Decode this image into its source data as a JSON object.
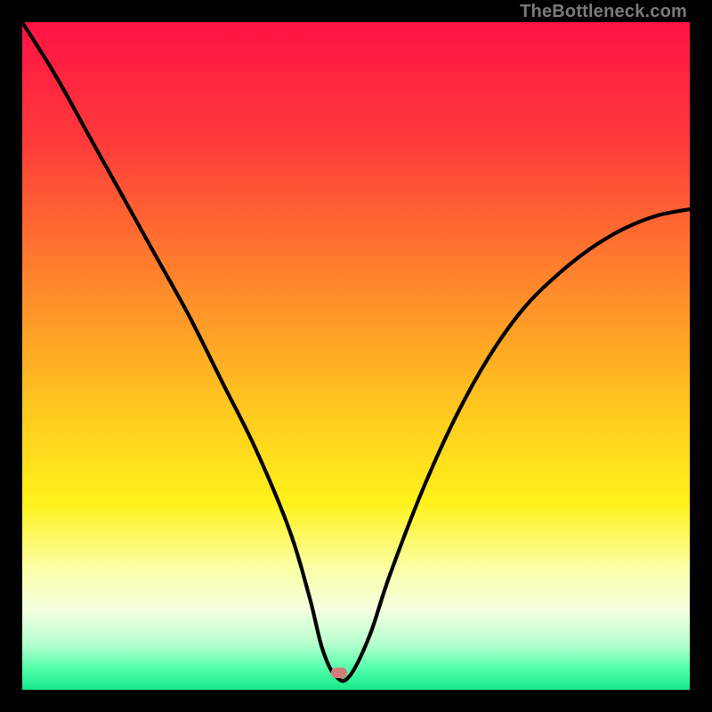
{
  "watermark": "TheBottleneck.com",
  "marker": {
    "x_pct": 47.5,
    "y_pct": 97.5,
    "color": "#d77a7a"
  },
  "gradient_stops": [
    {
      "offset": 0,
      "color": "#ff1244"
    },
    {
      "offset": 18,
      "color": "#ff3b3a"
    },
    {
      "offset": 40,
      "color": "#ff8a2a"
    },
    {
      "offset": 58,
      "color": "#ffc81f"
    },
    {
      "offset": 72,
      "color": "#fff21a"
    },
    {
      "offset": 82,
      "color": "#fbffa8"
    },
    {
      "offset": 88,
      "color": "#f4ffe0"
    },
    {
      "offset": 93,
      "color": "#b8ffcf"
    },
    {
      "offset": 97,
      "color": "#4fffa8"
    },
    {
      "offset": 100,
      "color": "#17e88a"
    }
  ],
  "chart_data": {
    "type": "line",
    "title": "",
    "xlabel": "",
    "ylabel": "",
    "xlim": [
      0,
      100
    ],
    "ylim": [
      0,
      100
    ],
    "note": "Bottleneck-style curve: y is mismatch percentage (high=red top, low=green bottom). Minimum near x≈47.",
    "series": [
      {
        "name": "curve",
        "x": [
          0,
          5,
          10,
          15,
          20,
          25,
          30,
          35,
          40,
          43,
          45,
          47,
          49,
          52,
          55,
          60,
          65,
          70,
          75,
          80,
          85,
          90,
          95,
          100
        ],
        "y": [
          100,
          92,
          83,
          74,
          65,
          56,
          46,
          36,
          24,
          14,
          6,
          2,
          2,
          8,
          17,
          30,
          41,
          50,
          57,
          62,
          66,
          69,
          71,
          72
        ]
      }
    ],
    "optimal_x": 47,
    "grid": false,
    "legend": false
  }
}
